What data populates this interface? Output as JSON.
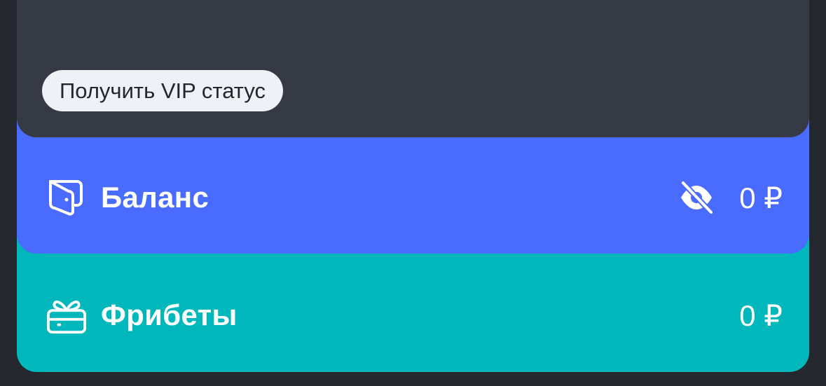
{
  "vip": {
    "label": "Получить VIP статус"
  },
  "balance": {
    "label": "Баланс",
    "amount": "0 ₽",
    "icon": "wallet-icon",
    "visibility_icon": "eye-off-icon"
  },
  "freebets": {
    "label": "Фрибеты",
    "amount": "0 ₽",
    "icon": "gift-icon"
  },
  "colors": {
    "background": "#24272e",
    "vip_card": "#363a45",
    "balance_card": "#4a6bff",
    "freebets_card": "#00b8bb",
    "pill": "#eef1f6"
  }
}
